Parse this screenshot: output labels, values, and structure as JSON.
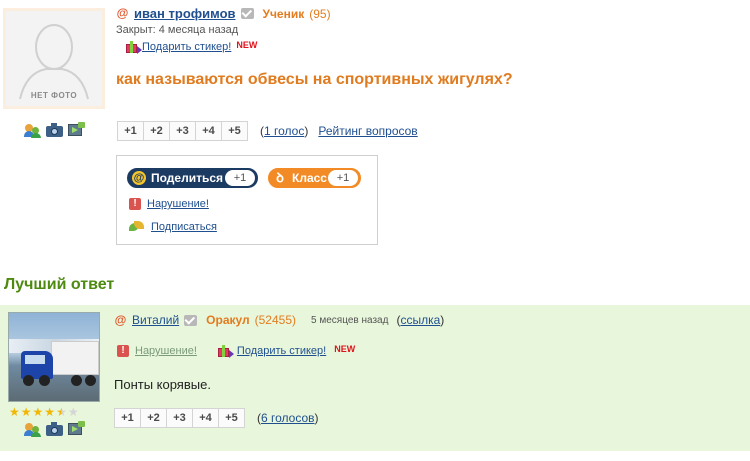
{
  "question": {
    "avatar_label": "НЕТ ФОТО",
    "author": "иван трофимов",
    "rank": "Ученик",
    "points": "(95)",
    "closed": "Закрыт: 4 месяца назад",
    "sticker_label": "Подарить стикер!",
    "new_badge": "NEW",
    "title": "как называются обвесы на спортивных жигулях?",
    "votes": [
      "+1",
      "+2",
      "+3",
      "+4",
      "+5"
    ],
    "vote_count": "1 голос",
    "rating_link": "Рейтинг вопросов"
  },
  "share": {
    "share_label": "Поделиться",
    "share_count": "+1",
    "class_label": "Класс",
    "class_count": "+1",
    "violation": "Нарушение!",
    "subscribe": "Подписаться"
  },
  "best_answer": {
    "heading": "Лучший ответ",
    "author": "Виталий",
    "rank": "Оракул",
    "points": "(52455)",
    "time": "5 месяцев назад",
    "link": "ссылка",
    "violation": "Нарушение!",
    "sticker_label": "Подарить стикер!",
    "new_badge": "NEW",
    "text": "Понты корявые.",
    "stars": 4.5,
    "votes": [
      "+1",
      "+2",
      "+3",
      "+4",
      "+5"
    ],
    "vote_count": "6 голосов"
  },
  "colors": {
    "accent_orange": "#e07b1f",
    "best_green": "#4f8a10",
    "panel_bg": "#e8f6dc",
    "link_blue": "#1f4f8f"
  }
}
